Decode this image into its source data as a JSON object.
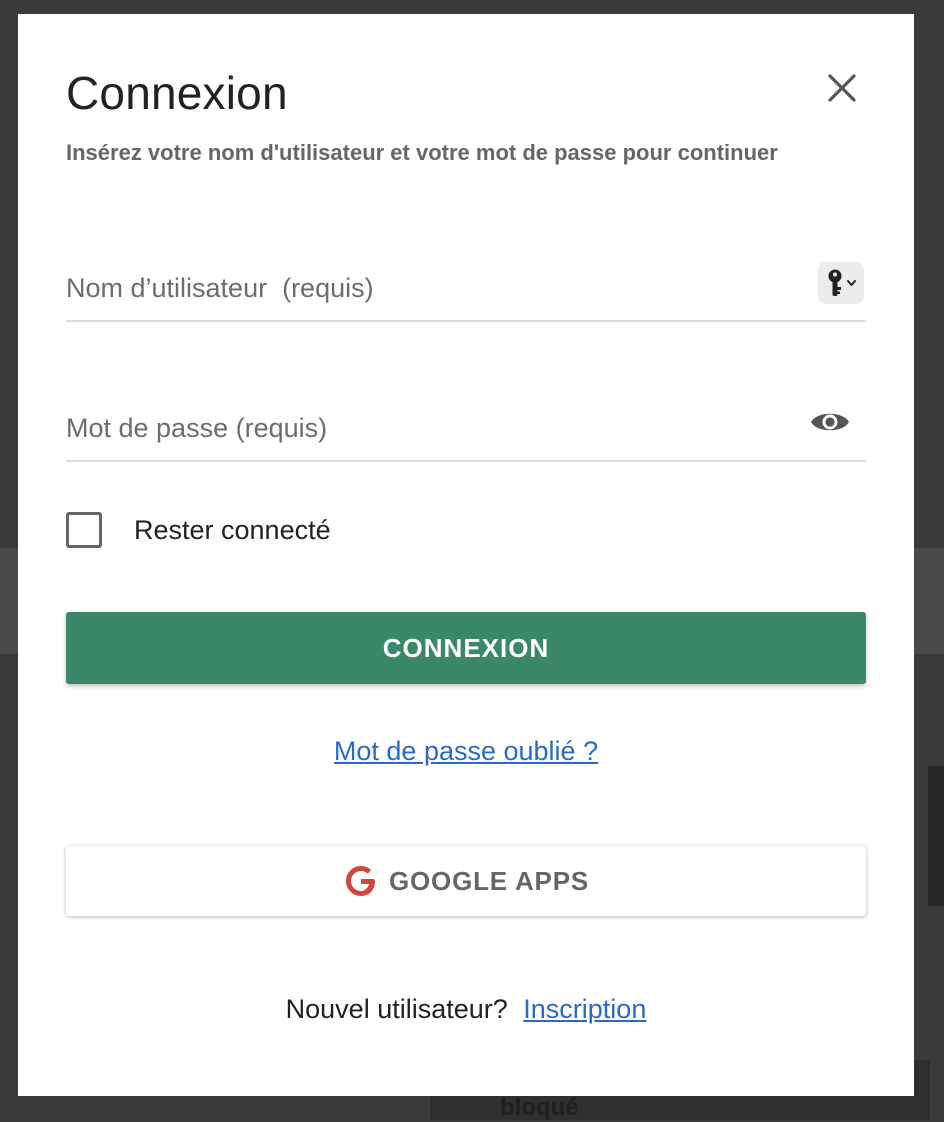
{
  "background": {
    "partial_text": "bloqué"
  },
  "modal": {
    "title": "Connexion",
    "subtitle": "Insérez votre nom d'utilisateur et votre mot de passe pour continuer",
    "close_icon": "close-icon"
  },
  "form": {
    "username": {
      "placeholder": "Nom d’utilisateur  (requis)",
      "value": "",
      "icon": "key-icon"
    },
    "password": {
      "placeholder": "Mot de passe (requis)",
      "value": "",
      "icon": "eye-icon"
    },
    "remember": {
      "label": "Rester connecté",
      "checked": false
    },
    "submit_label": "CONNEXION",
    "forgot_label": "Mot de passe oublié ?",
    "google_label": "GOOGLE APPS"
  },
  "footer": {
    "prompt": "Nouvel utilisateur?",
    "signup_label": "Inscription"
  },
  "colors": {
    "primary": "#3b8769",
    "link": "#2a6ac4",
    "google_red": "#d2473b"
  }
}
